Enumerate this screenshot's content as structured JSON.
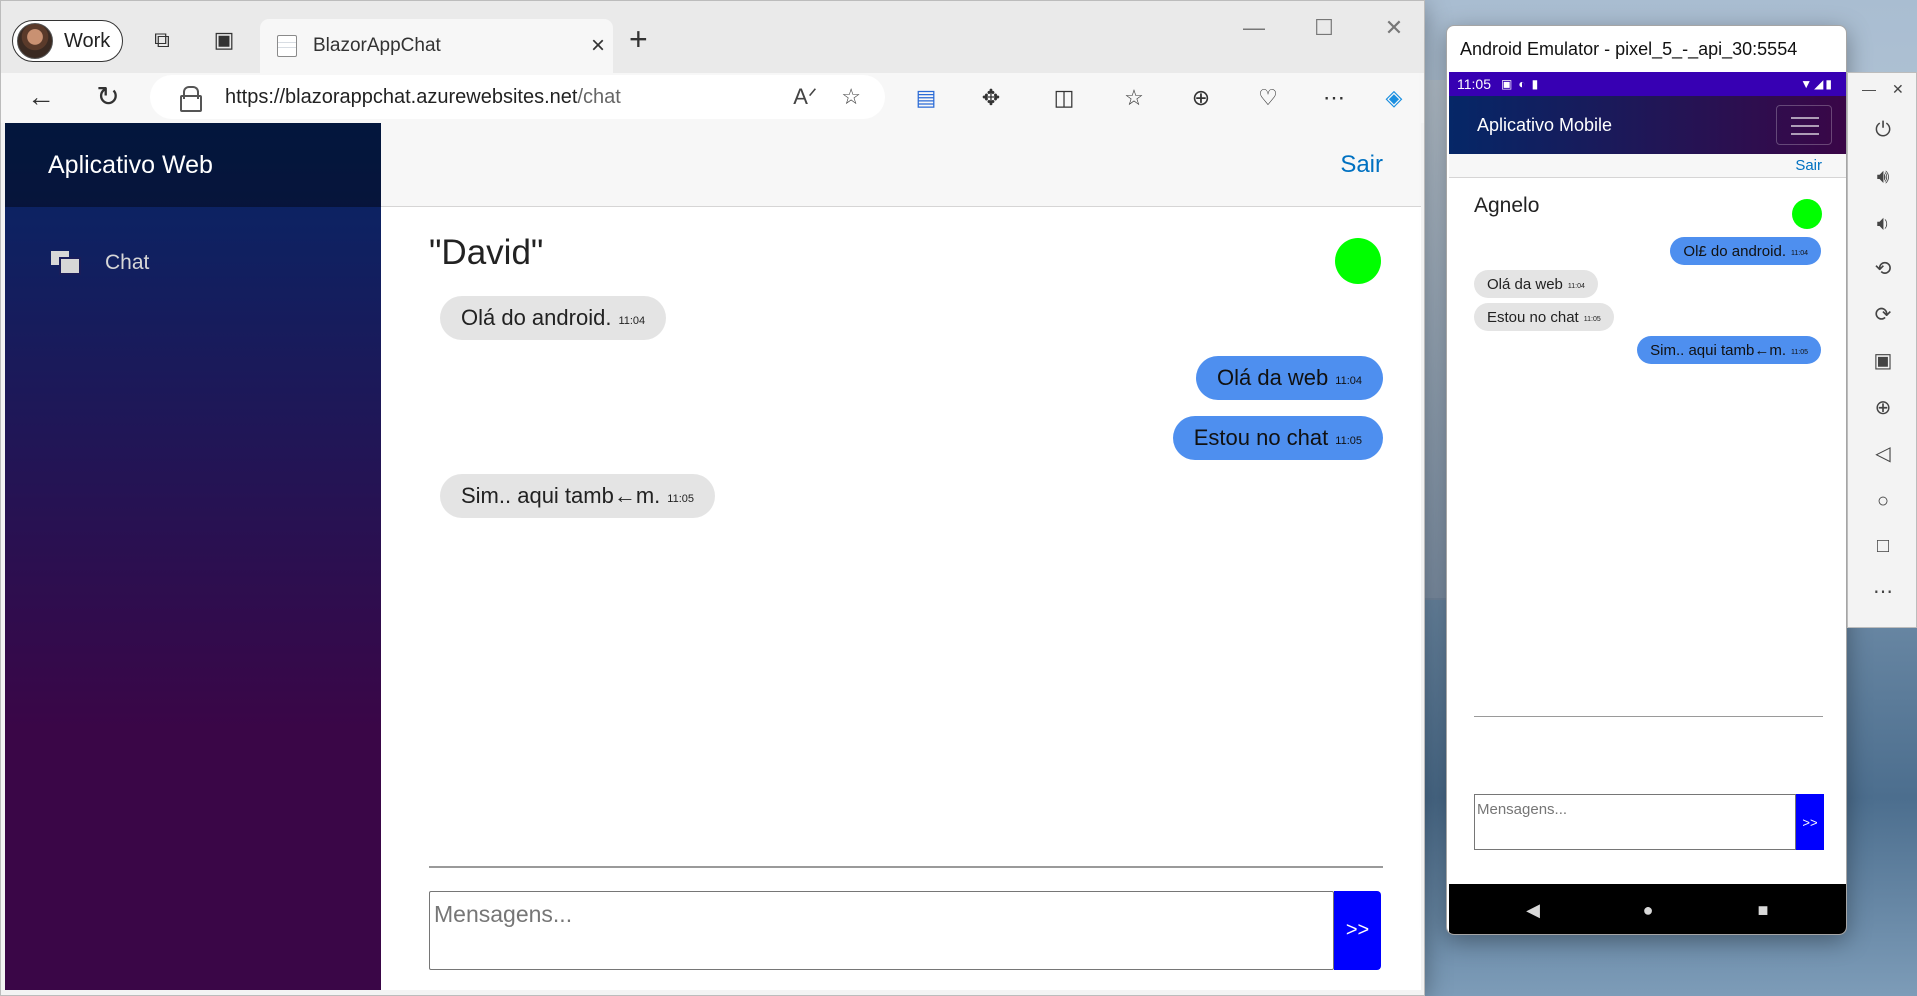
{
  "browser": {
    "profile_label": "Work",
    "tab_title": "BlazorAppChat",
    "url_host": "https://blazorappchat.azurewebsites.net",
    "url_path": "/chat",
    "icons": [
      "workspaces-icon",
      "vertical-tabs-icon",
      "back-icon",
      "refresh-icon",
      "read-aloud-icon",
      "favorite-star-icon",
      "app-available-icon",
      "extensions-icon",
      "split-screen-icon",
      "favorites-icon",
      "collections-icon",
      "browser-essentials-icon",
      "more-icon",
      "copilot-icon"
    ]
  },
  "web_app": {
    "brand": "Aplicativo Web",
    "nav_items": [
      {
        "label": "Chat",
        "icon": "chat-icon"
      }
    ],
    "signout": "Sair",
    "contact_name": "\"David\"",
    "status_color": "#00ff00",
    "messages": [
      {
        "text": "Olá do android.",
        "time": "11:04",
        "direction": "in"
      },
      {
        "text": "Olá da web",
        "time": "11:04",
        "direction": "out"
      },
      {
        "text": "Estou no chat",
        "time": "11:05",
        "direction": "out"
      },
      {
        "text": "Sim.. aqui tamb←m.",
        "time": "11:05",
        "direction": "in"
      }
    ],
    "input_placeholder": "Mensagens...",
    "send_label": ">>"
  },
  "emulator": {
    "window_title": "Android Emulator - pixel_5_-_api_30:5554",
    "status_time": "11:05",
    "app_title": "Aplicativo Mobile",
    "signout": "Sair",
    "contact_name": "Agnelo",
    "status_color": "#00ff00",
    "messages": [
      {
        "text": "Ol£ do android.",
        "time": "11:04",
        "direction": "out"
      },
      {
        "text": "Olá da web",
        "time": "11:04",
        "direction": "in"
      },
      {
        "text": "Estou no chat",
        "time": "11:05",
        "direction": "in"
      },
      {
        "text": "Sim.. aqui tamb←m.",
        "time": "11:05",
        "direction": "out"
      }
    ],
    "input_placeholder": "Mensagens...",
    "send_label": ">>",
    "side_controls": [
      "power-icon",
      "volume-up-icon",
      "volume-down-icon",
      "rotate-left-icon",
      "rotate-right-icon",
      "camera-icon",
      "zoom-icon",
      "back-icon",
      "home-icon",
      "overview-icon",
      "more-icon"
    ]
  },
  "colors": {
    "sidebar_top": "#052767",
    "sidebar_bottom": "#3a0647",
    "bubble_out": "#4e8fef",
    "bubble_in": "#e4e4e4",
    "send_button": "#0000ff",
    "link": "#0071c1"
  }
}
